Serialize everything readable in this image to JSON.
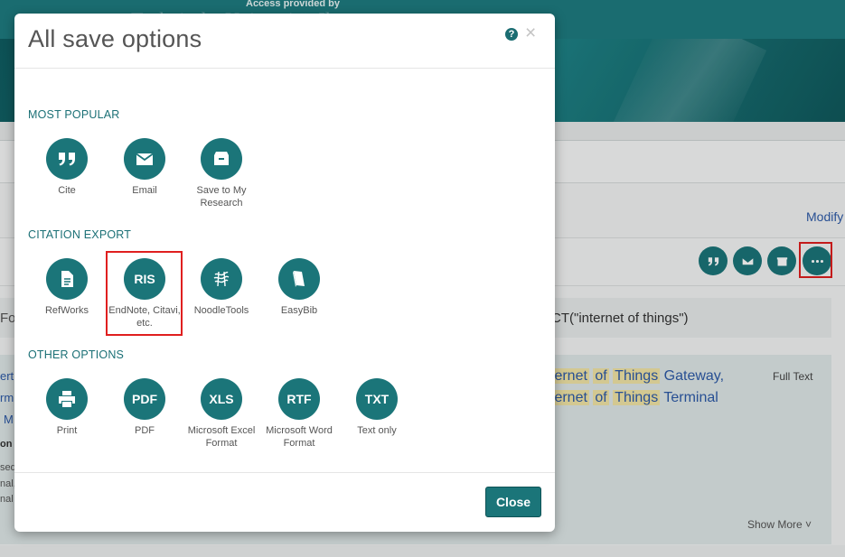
{
  "background": {
    "access_text": "Access provided by",
    "institution_text": "Technische Universität Ilmenau",
    "modify_link": "Modify",
    "query_prefix": "Fo",
    "query_text": "ACT(\"internet of things\")",
    "result": {
      "title_line1": {
        "pre": "ternet",
        "hl1": "of",
        "hl2": "Things",
        "post": " Gateway,"
      },
      "title_line2": {
        "pre": "ternet",
        "hl1": "of",
        "hl2": "Things",
        "post": " Terminal"
      },
      "full_text_label": "Full Text",
      "show_more_label": "Show More ˅",
      "left_fragments": [
        "ert",
        "rm",
        "M",
        "on",
        "sed",
        "nal,",
        "nal"
      ]
    },
    "toolbar_icons": [
      "cite-icon",
      "email-icon",
      "save-icon",
      "more-icon"
    ]
  },
  "modal": {
    "title": "All save options",
    "help_label": "?",
    "close_label": "×",
    "sections": {
      "most_popular": {
        "label": "MOST POPULAR",
        "items": [
          {
            "label": "Cite",
            "icon": "quote-icon"
          },
          {
            "label": "Email",
            "icon": "envelope-icon"
          },
          {
            "label": "Save to My Research",
            "icon": "archive-box-icon"
          }
        ]
      },
      "citation_export": {
        "label": "CITATION EXPORT",
        "items": [
          {
            "label": "RefWorks",
            "icon": "document-icon"
          },
          {
            "label": "EndNote, Citavi, etc.",
            "badge": "RIS"
          },
          {
            "label": "NoodleTools",
            "icon": "noodle-icon"
          },
          {
            "label": "EasyBib",
            "icon": "book-icon"
          }
        ]
      },
      "other_options": {
        "label": "OTHER OPTIONS",
        "items": [
          {
            "label": "Print",
            "icon": "printer-icon"
          },
          {
            "label": "PDF",
            "badge": "PDF"
          },
          {
            "label": "Microsoft Excel Format",
            "badge": "XLS"
          },
          {
            "label": "Microsoft Word Format",
            "badge": "RTF"
          },
          {
            "label": "Text only",
            "badge": "TXT"
          }
        ]
      }
    },
    "close_button": "Close"
  },
  "colors": {
    "accent": "#1b7579",
    "highlight_border": "#e01f1f",
    "header": "#1e7c80"
  }
}
